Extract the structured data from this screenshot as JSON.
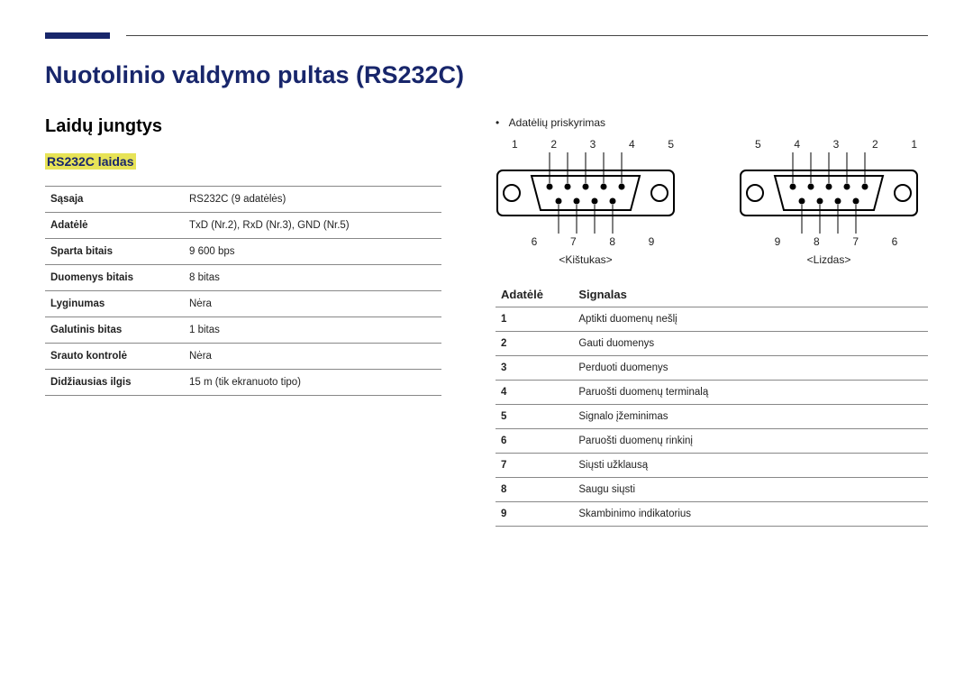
{
  "page": {
    "title": "Nuotolinio valdymo pultas (RS232C)",
    "section": "Laidų jungtys",
    "sub": "RS232C laidas"
  },
  "spec_rows": [
    {
      "label": "Sąsaja",
      "value": "RS232C (9 adatėlės)"
    },
    {
      "label": "Adatėlė",
      "value": "TxD (Nr.2), RxD (Nr.3), GND (Nr.5)"
    },
    {
      "label": "Sparta bitais",
      "value": "9 600 bps"
    },
    {
      "label": "Duomenys bitais",
      "value": "8 bitas"
    },
    {
      "label": "Lyginumas",
      "value": "Nėra"
    },
    {
      "label": "Galutinis bitas",
      "value": "1 bitas"
    },
    {
      "label": "Srauto kontrolė",
      "value": "Nėra"
    },
    {
      "label": "Didžiausias ilgis",
      "value": "15 m (tik ekranuoto tipo)"
    }
  ],
  "right": {
    "bullet": "Adatėlių priskyrimas",
    "plug_top": "1  2  3  4  5",
    "plug_bottom": "6  7  8  9",
    "plug_label": "<Kištukas>",
    "socket_top": "5  4  3  2  1",
    "socket_bottom": "9  8  7  6",
    "socket_label": "<Lizdas>",
    "col_pin": "Adatėlė",
    "col_sig": "Signalas"
  },
  "signals": [
    {
      "pin": "1",
      "sig": "Aptikti duomenų nešlį"
    },
    {
      "pin": "2",
      "sig": "Gauti duomenys"
    },
    {
      "pin": "3",
      "sig": "Perduoti duomenys"
    },
    {
      "pin": "4",
      "sig": "Paruošti duomenų terminalą"
    },
    {
      "pin": "5",
      "sig": "Signalo įžeminimas"
    },
    {
      "pin": "6",
      "sig": "Paruošti duomenų rinkinį"
    },
    {
      "pin": "7",
      "sig": "Siųsti užklausą"
    },
    {
      "pin": "8",
      "sig": "Saugu siųsti"
    },
    {
      "pin": "9",
      "sig": "Skambinimo indikatorius"
    }
  ]
}
